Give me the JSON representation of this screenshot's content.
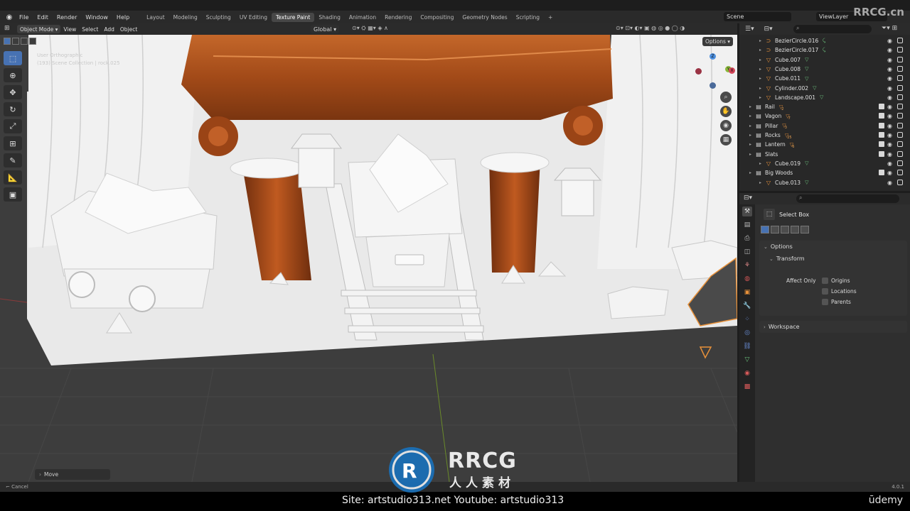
{
  "menu": {
    "items": [
      "File",
      "Edit",
      "Render",
      "Window",
      "Help"
    ],
    "workspaces": [
      "Layout",
      "Modeling",
      "Sculpting",
      "UV Editing",
      "Texture Paint",
      "Shading",
      "Animation",
      "Rendering",
      "Compositing",
      "Geometry Nodes",
      "Scripting"
    ],
    "active_workspace": "Texture Paint",
    "add_tab": "+",
    "scene": "Scene",
    "view_layer": "ViewLayer"
  },
  "watermark_top": "RRCG.cn",
  "viewport": {
    "mode": "Object Mode",
    "menus": [
      "View",
      "Select",
      "Add",
      "Object"
    ],
    "transform_orientation": "Global",
    "options_label": "Options",
    "info_line1": "User Orthographic",
    "info_line2": "(193) Scene Collection | rock.025",
    "last_operator": "Move"
  },
  "gizmo": {
    "z": "Z",
    "y": "Y",
    "x": "X"
  },
  "outliner": {
    "rows": [
      {
        "name": "BezierCircle.016",
        "kind": "curve",
        "indent": 2
      },
      {
        "name": "BezierCircle.017",
        "kind": "curve",
        "indent": 2
      },
      {
        "name": "Cube.007",
        "kind": "mesh",
        "indent": 2
      },
      {
        "name": "Cube.008",
        "kind": "mesh",
        "indent": 2
      },
      {
        "name": "Cube.011",
        "kind": "mesh",
        "indent": 2
      },
      {
        "name": "Cylinder.002",
        "kind": "mesh",
        "indent": 2
      },
      {
        "name": "Landscape.001",
        "kind": "mesh",
        "indent": 2
      },
      {
        "name": "Rail",
        "kind": "collection",
        "indent": 1,
        "count": "2"
      },
      {
        "name": "Vagon",
        "kind": "collection",
        "indent": 1,
        "count": "7"
      },
      {
        "name": "Pillar",
        "kind": "collection",
        "indent": 1,
        "count": "3"
      },
      {
        "name": "Rocks",
        "kind": "collection",
        "indent": 1,
        "count": "25"
      },
      {
        "name": "Lantern",
        "kind": "collection",
        "indent": 1,
        "count": "6"
      },
      {
        "name": "Slats",
        "kind": "collection",
        "indent": 1
      },
      {
        "name": "Cube.019",
        "kind": "mesh",
        "indent": 2
      },
      {
        "name": "Big Woods",
        "kind": "collection",
        "indent": 1
      },
      {
        "name": "Cube.013",
        "kind": "mesh",
        "indent": 2
      }
    ]
  },
  "properties": {
    "tool_name": "Select Box",
    "options_label": "Options",
    "transform_label": "Transform",
    "affect_only_label": "Affect Only",
    "checkboxes": [
      "Origins",
      "Locations",
      "Parents"
    ],
    "workspace_label": "Workspace"
  },
  "status": {
    "cancel": "Cancel",
    "version": "4.0.1"
  },
  "footer": {
    "site": "Site: artstudio313.net      Youtube: artstudio313",
    "udemy": "ūdemy",
    "rrcg": "RRCG",
    "rrcg_cn": "人人素材"
  },
  "colors": {
    "accent": "#4772b3",
    "wood": "#b5551c",
    "mesh_icon": "#6cc17d",
    "object_icon": "#e8913a"
  }
}
